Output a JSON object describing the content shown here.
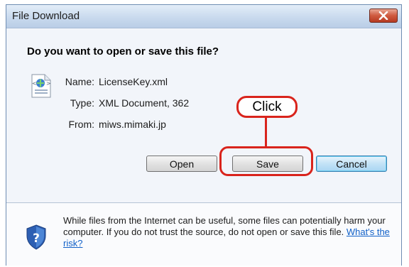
{
  "window": {
    "title": "File Download"
  },
  "dialog": {
    "question": "Do you want to open or save this file?",
    "file": {
      "name_label": "Name:",
      "name_value": "LicenseKey.xml",
      "type_label": "Type:",
      "type_value": "XML Document, 362",
      "from_label": "From:",
      "from_value": "miws.mimaki.jp"
    },
    "buttons": {
      "open": "Open",
      "save": "Save",
      "cancel": "Cancel"
    },
    "callout": "Click"
  },
  "footer": {
    "warning": "While files from the Internet can be useful, some files can potentially harm your computer. If you do not trust the source, do not open or save this file.",
    "link": "What's the risk?"
  },
  "colors": {
    "annotation": "#d9241c",
    "link": "#1060c8"
  },
  "icons": [
    "close-icon",
    "xml-file-icon",
    "shield-help-icon"
  ]
}
